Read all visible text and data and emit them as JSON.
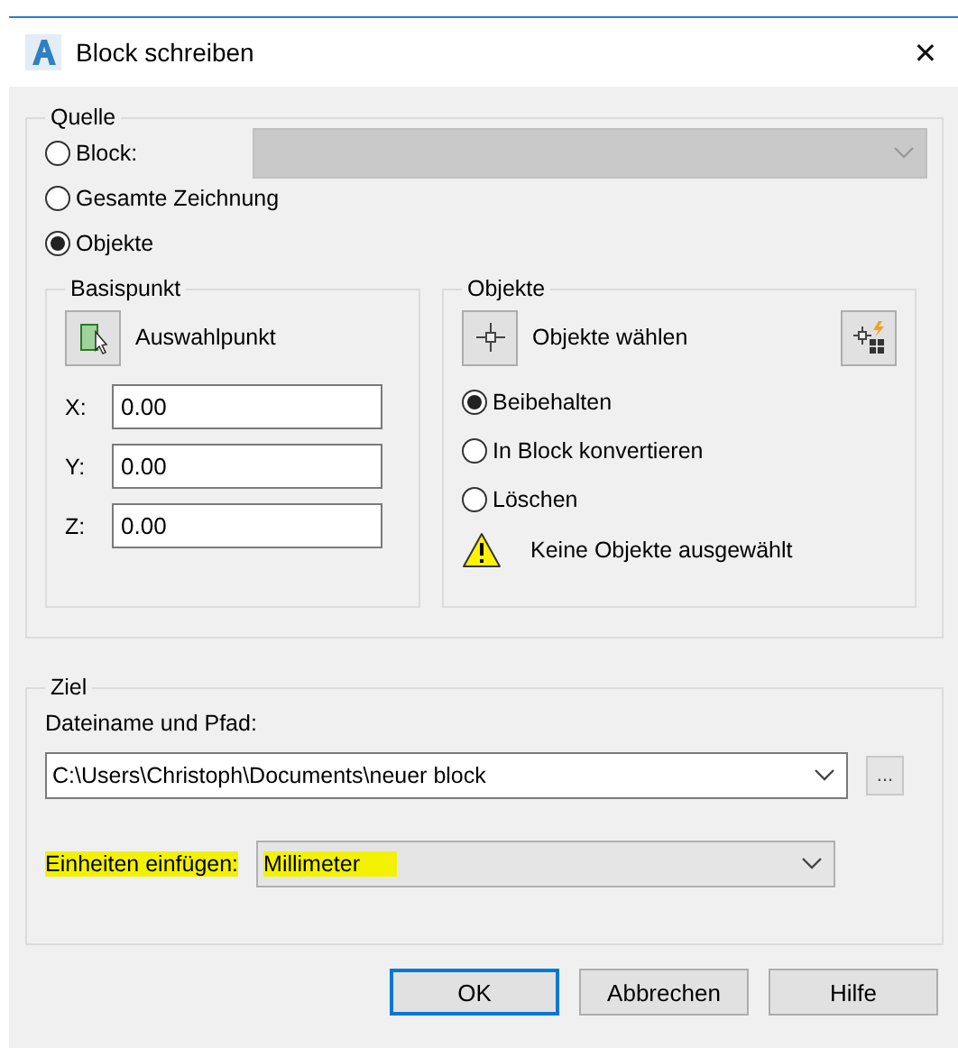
{
  "window": {
    "title": "Block schreiben",
    "close": "✕"
  },
  "source": {
    "title": "Quelle",
    "options": [
      {
        "label": "Block:",
        "selected": false
      },
      {
        "label": "Gesamte Zeichnung",
        "selected": false
      },
      {
        "label": "Objekte",
        "selected": true
      }
    ],
    "block_combo": {
      "disabled": true
    }
  },
  "base_point": {
    "title": "Basispunkt",
    "pick_label": "Auswahlpunkt",
    "fields": [
      {
        "label": "X:",
        "value": "0.00"
      },
      {
        "label": "Y:",
        "value": "0.00"
      },
      {
        "label": "Z:",
        "value": "0.00"
      }
    ]
  },
  "objects": {
    "title": "Objekte",
    "select_label": "Objekte wählen",
    "options": [
      {
        "label": "Beibehalten",
        "selected": true
      },
      {
        "label": "In Block konvertieren",
        "selected": false
      },
      {
        "label": "Löschen",
        "selected": false
      }
    ],
    "warning": "Keine Objekte ausgewählt"
  },
  "target": {
    "title": "Ziel",
    "path_label": "Dateiname und Pfad:",
    "path": "C:\\Users\\Christoph\\Documents\\neuer block",
    "browse": "...",
    "units_label": "Einheiten einfügen:",
    "units": "Millimeter",
    "highlighted": true
  },
  "buttons": [
    {
      "label": "OK",
      "default": true
    },
    {
      "label": "Abbrechen",
      "default": false
    },
    {
      "label": "Hilfe",
      "default": false
    }
  ]
}
